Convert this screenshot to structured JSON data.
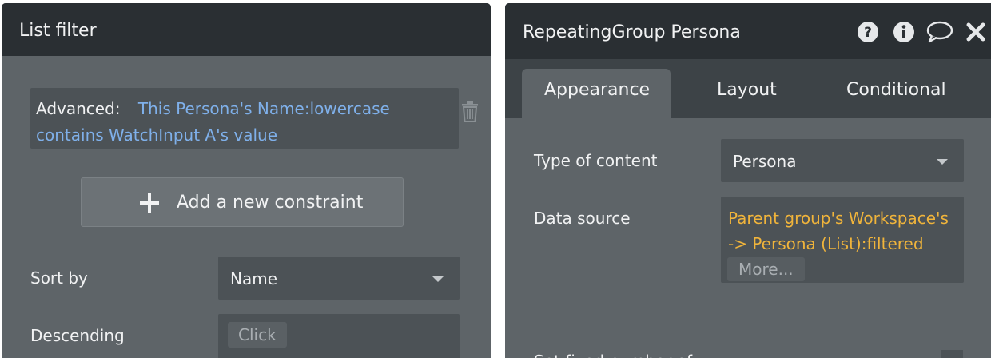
{
  "list_filter": {
    "title": "List filter",
    "advanced_label": "Advanced:",
    "advanced_expr_line1": "This Persona's Name:lowercase",
    "advanced_expr_line2": "contains WatchInput A's value",
    "add_constraint_label": "Add a new constraint",
    "sort_by_label": "Sort by",
    "sort_by_value": "Name",
    "descending_label": "Descending",
    "descending_button": "Click"
  },
  "property_editor": {
    "title": "RepeatingGroup Persona",
    "tabs": [
      {
        "label": "Appearance",
        "active": true
      },
      {
        "label": "Layout",
        "active": false
      },
      {
        "label": "Conditional",
        "active": false
      }
    ],
    "type_of_content_label": "Type of content",
    "type_of_content_value": "Persona",
    "data_source_label": "Data source",
    "data_source_line1": "Parent group's Workspace's",
    "data_source_line2": "-> Persona (List):filtered",
    "more_button": "More...",
    "cut_off_text": "Set fixed number of"
  },
  "icons": {
    "trash": "trash-icon",
    "plus": "plus-icon",
    "help": "question-circle-icon",
    "info": "info-circle-icon",
    "comment": "speech-bubble-icon",
    "close": "close-icon"
  },
  "colors": {
    "panel_bg": "#5e6468",
    "header_bg": "#2a2f33",
    "field_bg": "#4c5256",
    "expression_blue": "#7fb0ea",
    "expression_orange": "#f0b43b"
  }
}
